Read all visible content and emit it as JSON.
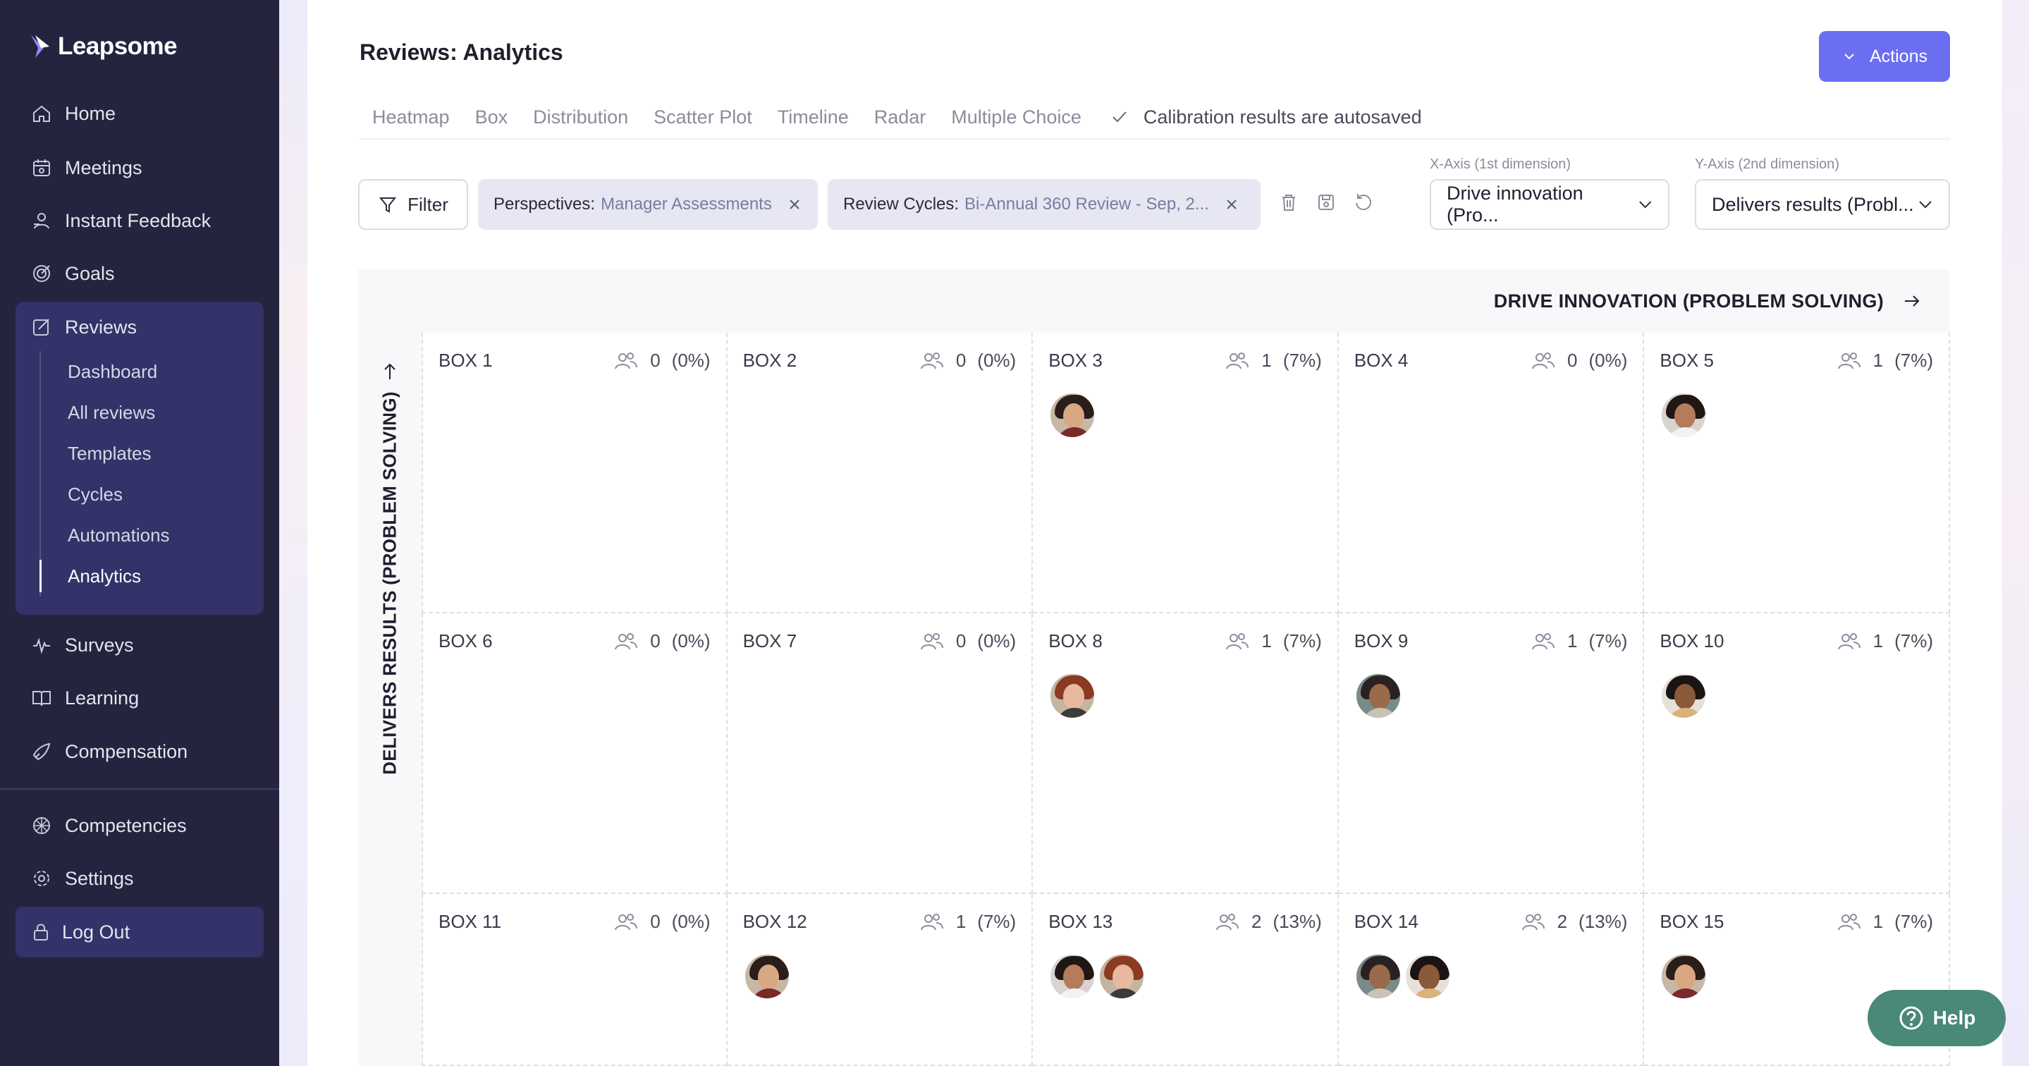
{
  "app": {
    "name": "Leapsome"
  },
  "sidebar": {
    "items": [
      {
        "label": "Home",
        "icon": "home-icon"
      },
      {
        "label": "Meetings",
        "icon": "meetings-icon"
      },
      {
        "label": "Instant Feedback",
        "icon": "feedback-icon"
      },
      {
        "label": "Goals",
        "icon": "goals-icon"
      },
      {
        "label": "Reviews",
        "icon": "reviews-icon"
      },
      {
        "label": "Surveys",
        "icon": "surveys-icon"
      },
      {
        "label": "Learning",
        "icon": "learning-icon"
      },
      {
        "label": "Compensation",
        "icon": "compensation-icon"
      },
      {
        "label": "Competencies",
        "icon": "competencies-icon"
      },
      {
        "label": "Settings",
        "icon": "settings-icon"
      }
    ],
    "reviews_sub": [
      "Dashboard",
      "All reviews",
      "Templates",
      "Cycles",
      "Automations",
      "Analytics"
    ],
    "logout": "Log Out"
  },
  "header": {
    "title": "Reviews: Analytics",
    "actions_label": "Actions"
  },
  "tabs": [
    "Heatmap",
    "Box",
    "Distribution",
    "Scatter Plot",
    "Timeline",
    "Radar",
    "Multiple Choice"
  ],
  "autosave_text": "Calibration results are autosaved",
  "filter": {
    "button_label": "Filter",
    "chips": [
      {
        "key": "Perspectives:",
        "value": "Manager Assessments"
      },
      {
        "key": "Review Cycles:",
        "value": "Bi-Annual 360 Review - Sep, 2..."
      }
    ]
  },
  "axes": {
    "x_caption": "X-Axis (1st dimension)",
    "x_value": "Drive innovation (Pro...",
    "y_caption": "Y-Axis (2nd dimension)",
    "y_value": "Delivers results (Probl..."
  },
  "grid": {
    "x_title": "DRIVE INNOVATION (PROBLEM SOLVING)",
    "y_title": "DELIVERS RESULTS (PROBLEM SOLVING)",
    "boxes": [
      {
        "label": "BOX 1",
        "count": "0",
        "pct": "(0%)",
        "people": 0
      },
      {
        "label": "BOX 2",
        "count": "0",
        "pct": "(0%)",
        "people": 0
      },
      {
        "label": "BOX 3",
        "count": "1",
        "pct": "(7%)",
        "people": 1
      },
      {
        "label": "BOX 4",
        "count": "0",
        "pct": "(0%)",
        "people": 0
      },
      {
        "label": "BOX 5",
        "count": "1",
        "pct": "(7%)",
        "people": 1
      },
      {
        "label": "BOX 6",
        "count": "0",
        "pct": "(0%)",
        "people": 0
      },
      {
        "label": "BOX 7",
        "count": "0",
        "pct": "(0%)",
        "people": 0
      },
      {
        "label": "BOX 8",
        "count": "1",
        "pct": "(7%)",
        "people": 1
      },
      {
        "label": "BOX 9",
        "count": "1",
        "pct": "(7%)",
        "people": 1
      },
      {
        "label": "BOX 10",
        "count": "1",
        "pct": "(7%)",
        "people": 1
      },
      {
        "label": "BOX 11",
        "count": "0",
        "pct": "(0%)",
        "people": 0
      },
      {
        "label": "BOX 12",
        "count": "1",
        "pct": "(7%)",
        "people": 1
      },
      {
        "label": "BOX 13",
        "count": "2",
        "pct": "(13%)",
        "people": 2
      },
      {
        "label": "BOX 14",
        "count": "2",
        "pct": "(13%)",
        "people": 2
      },
      {
        "label": "BOX 15",
        "count": "1",
        "pct": "(7%)",
        "people": 1
      }
    ]
  },
  "help_label": "Help",
  "colors": {
    "sidebar_bg": "#25243f",
    "accent": "#6b6ef0",
    "help_bg": "#4a8877"
  }
}
